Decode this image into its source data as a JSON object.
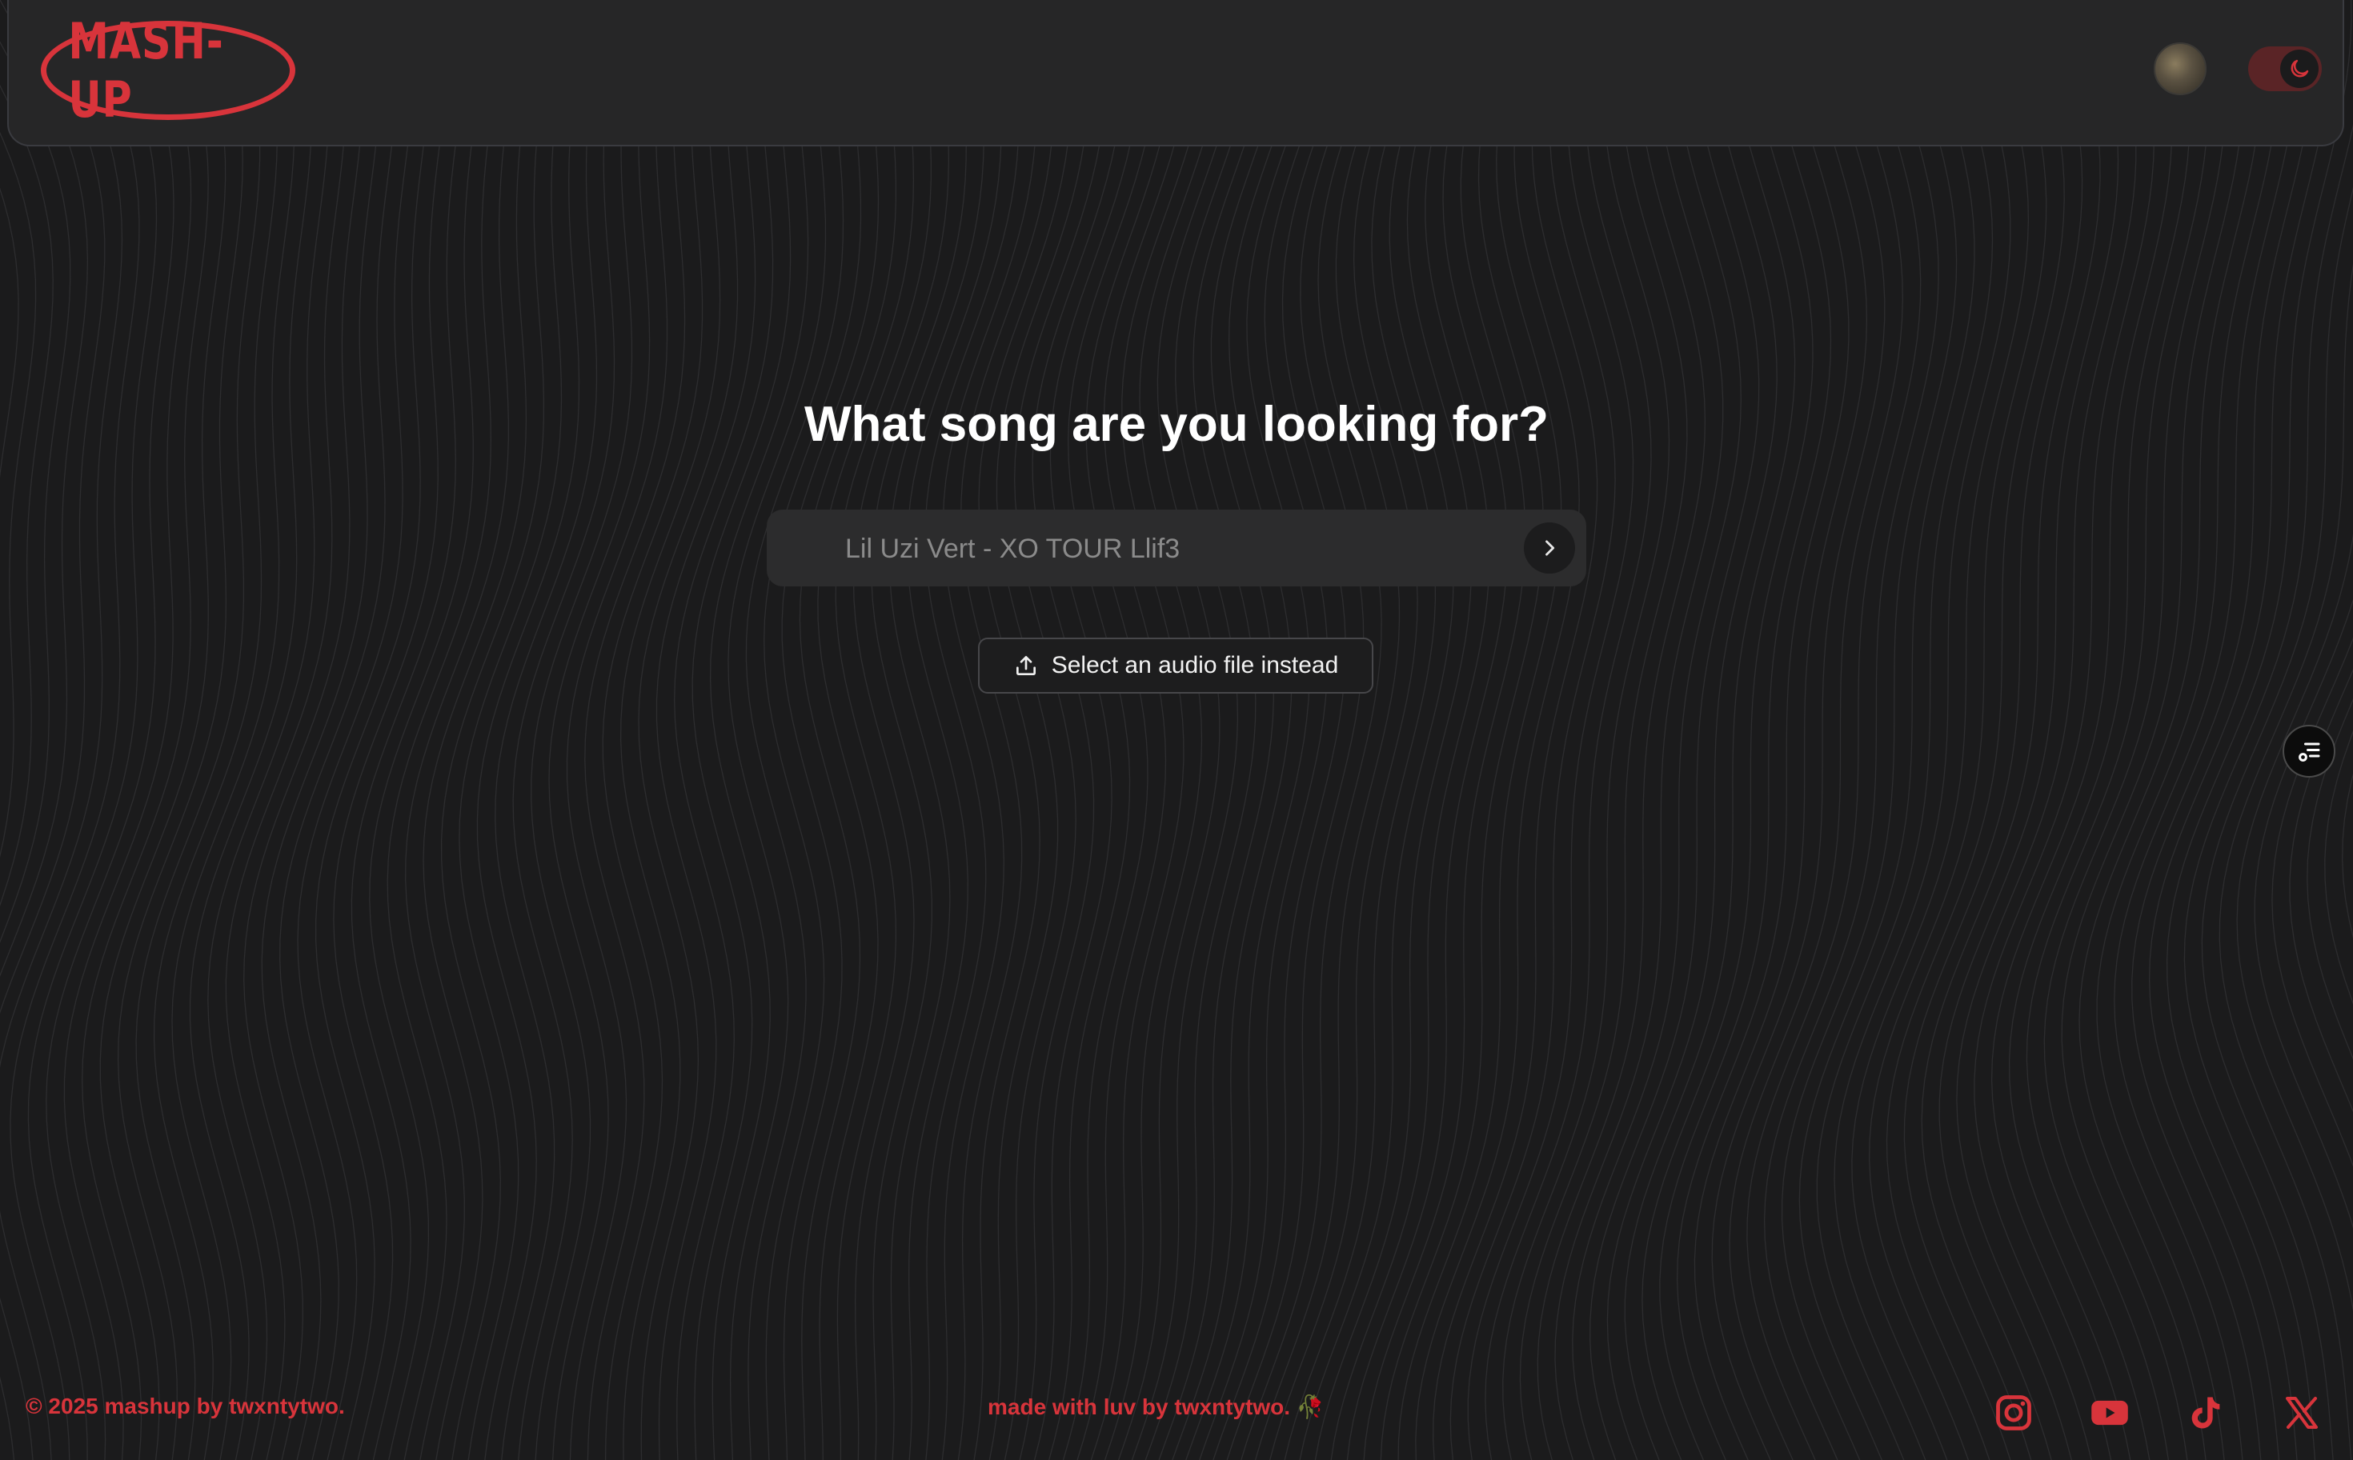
{
  "header": {
    "logo_text": "MASH-UP",
    "avatar_icon": "user-avatar",
    "theme_toggle_icon": "moon-icon"
  },
  "main": {
    "headline": "What song are you looking for?",
    "search": {
      "placeholder": "Lil Uzi Vert - XO TOUR Llif3",
      "value": "",
      "submit_icon": "chevron-right-icon"
    },
    "upload_button": {
      "label": "Select an audio file instead",
      "icon": "upload-icon"
    },
    "side_button_icon": "playlist-icon"
  },
  "footer": {
    "copyright": "© 2025 mashup by twxntytwo.",
    "made_with": "made with luv by twxntytwo. 🥀",
    "social": [
      {
        "name": "instagram",
        "icon": "instagram-icon"
      },
      {
        "name": "youtube",
        "icon": "youtube-icon"
      },
      {
        "name": "tiktok",
        "icon": "tiktok-icon"
      },
      {
        "name": "x",
        "icon": "x-icon"
      }
    ]
  },
  "colors": {
    "accent": "#d8343b",
    "background": "#1b1b1c",
    "header": "#262627",
    "input": "#2c2c2d"
  }
}
